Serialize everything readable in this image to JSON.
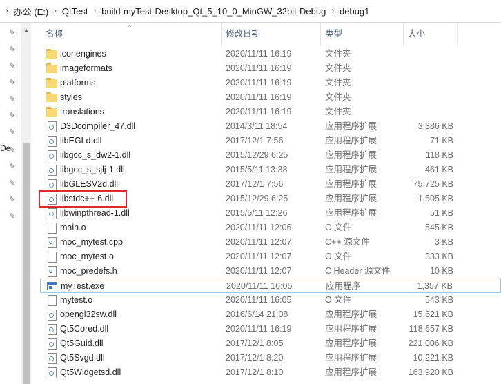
{
  "breadcrumb": [
    "办公 (E:)",
    "QtTest",
    "build-myTest-Desktop_Qt_5_10_0_MinGW_32bit-Debug",
    "debug1"
  ],
  "left_pane_text": "De",
  "columns": {
    "name": "名称",
    "date": "修改日期",
    "type": "类型",
    "size": "大小"
  },
  "files": [
    {
      "icon": "folder-icon",
      "name": "iconengines",
      "date": "2020/11/11 16:19",
      "type": "文件夹",
      "size": ""
    },
    {
      "icon": "folder-icon",
      "name": "imageformats",
      "date": "2020/11/11 16:19",
      "type": "文件夹",
      "size": ""
    },
    {
      "icon": "folder-icon",
      "name": "platforms",
      "date": "2020/11/11 16:19",
      "type": "文件夹",
      "size": ""
    },
    {
      "icon": "folder-icon",
      "name": "styles",
      "date": "2020/11/11 16:19",
      "type": "文件夹",
      "size": ""
    },
    {
      "icon": "folder-icon",
      "name": "translations",
      "date": "2020/11/11 16:19",
      "type": "文件夹",
      "size": ""
    },
    {
      "icon": "dll-icon",
      "name": "D3Dcompiler_47.dll",
      "date": "2014/3/11 18:54",
      "type": "应用程序扩展",
      "size": "3,386 KB"
    },
    {
      "icon": "dll-icon",
      "name": "libEGLd.dll",
      "date": "2017/12/1 7:56",
      "type": "应用程序扩展",
      "size": "71 KB"
    },
    {
      "icon": "dll-icon",
      "name": "libgcc_s_dw2-1.dll",
      "date": "2015/12/29 6:25",
      "type": "应用程序扩展",
      "size": "118 KB"
    },
    {
      "icon": "dll-icon",
      "name": "libgcc_s_sjlj-1.dll",
      "date": "2015/5/11 13:38",
      "type": "应用程序扩展",
      "size": "461 KB"
    },
    {
      "icon": "dll-icon",
      "name": "libGLESV2d.dll",
      "date": "2017/12/1 7:56",
      "type": "应用程序扩展",
      "size": "75,725 KB"
    },
    {
      "icon": "dll-icon",
      "name": "libstdc++-6.dll",
      "date": "2015/12/29 6:25",
      "type": "应用程序扩展",
      "size": "1,505 KB"
    },
    {
      "icon": "dll-icon",
      "name": "libwinpthread-1.dll",
      "date": "2015/5/11 12:26",
      "type": "应用程序扩展",
      "size": "51 KB"
    },
    {
      "icon": "file-icon",
      "name": "main.o",
      "date": "2020/11/11 12:06",
      "type": "O 文件",
      "size": "545 KB"
    },
    {
      "icon": "cpp-file-icon",
      "name": "moc_mytest.cpp",
      "date": "2020/11/11 12:07",
      "type": "C++ 源文件",
      "size": "3 KB"
    },
    {
      "icon": "file-icon",
      "name": "moc_mytest.o",
      "date": "2020/11/11 12:07",
      "type": "O 文件",
      "size": "333 KB"
    },
    {
      "icon": "c-header-icon",
      "name": "moc_predefs.h",
      "date": "2020/11/11 12:07",
      "type": "C Header 源文件",
      "size": "10 KB"
    },
    {
      "icon": "exe-icon",
      "name": "myTest.exe",
      "date": "2020/11/11 16:05",
      "type": "应用程序",
      "size": "1,357 KB"
    },
    {
      "icon": "file-icon",
      "name": "mytest.o",
      "date": "2020/11/11 16:05",
      "type": "O 文件",
      "size": "543 KB"
    },
    {
      "icon": "dll-icon",
      "name": "opengl32sw.dll",
      "date": "2016/6/14 21:08",
      "type": "应用程序扩展",
      "size": "15,621 KB"
    },
    {
      "icon": "dll-icon",
      "name": "Qt5Cored.dll",
      "date": "2020/11/11 16:19",
      "type": "应用程序扩展",
      "size": "118,657 KB"
    },
    {
      "icon": "dll-icon",
      "name": "Qt5Guid.dll",
      "date": "2017/12/1 8:05",
      "type": "应用程序扩展",
      "size": "221,006 KB"
    },
    {
      "icon": "dll-icon",
      "name": "Qt5Svgd.dll",
      "date": "2017/12/1 8:20",
      "type": "应用程序扩展",
      "size": "10,221 KB"
    },
    {
      "icon": "dll-icon",
      "name": "Qt5Widgetsd.dll",
      "date": "2017/12/1 8:10",
      "type": "应用程序扩展",
      "size": "163,920 KB"
    }
  ],
  "colors": {
    "highlight_box": "#e1262c",
    "selection_border": "#99c9ef",
    "header_text": "#4c607a"
  }
}
